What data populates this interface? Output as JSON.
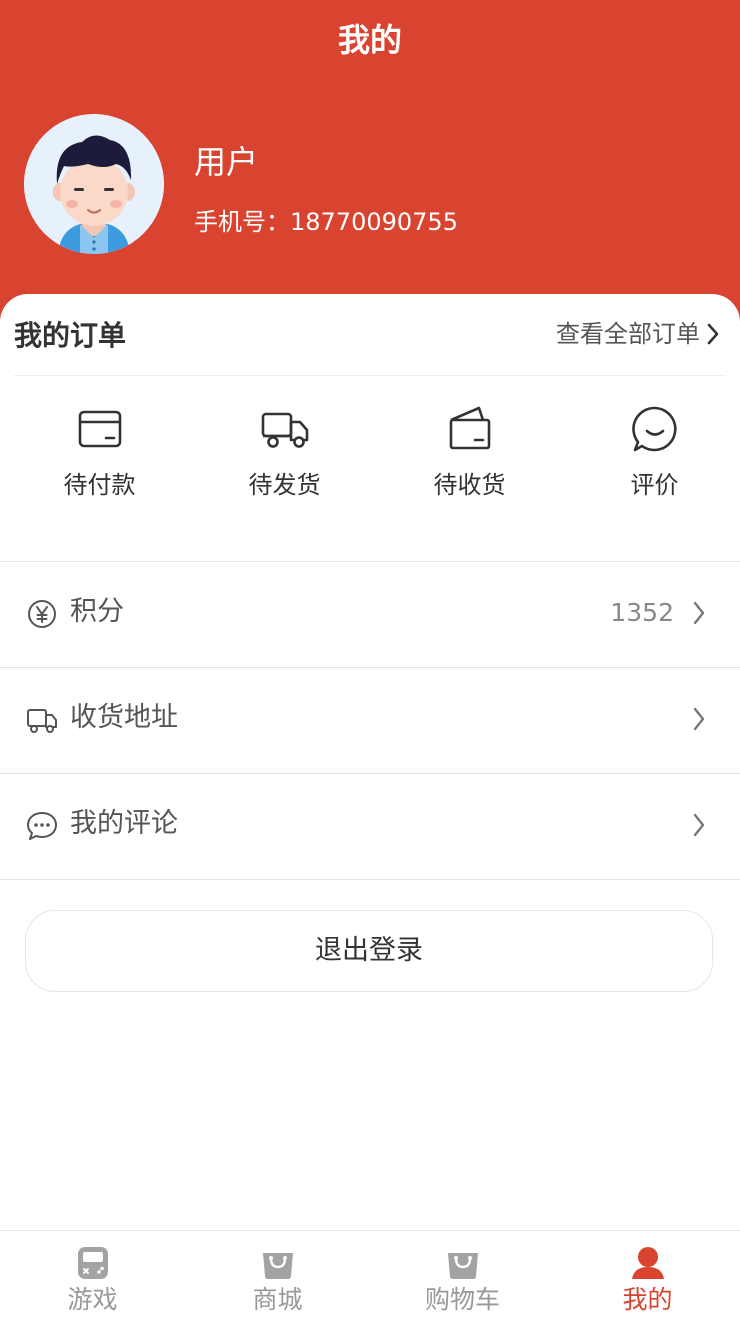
{
  "header": {
    "title": "我的",
    "bg_color": "#d94430"
  },
  "user": {
    "name": "用户",
    "phone": "手机号：18770090755",
    "avatar_icon": "avatar-boy-icon"
  },
  "orders": {
    "title": "我的订单",
    "view_all": "查看全部订单",
    "items": [
      {
        "label": "待付款",
        "icon": "wallet-icon"
      },
      {
        "label": "待发货",
        "icon": "truck-icon"
      },
      {
        "label": "待收货",
        "icon": "package-icon"
      },
      {
        "label": "评价",
        "icon": "comment-icon"
      }
    ]
  },
  "menu": [
    {
      "label": "积分",
      "value": "1352",
      "icon": "yuan-icon"
    },
    {
      "label": "收货地址",
      "value": "",
      "icon": "truck-icon"
    },
    {
      "label": "我的评论",
      "value": "",
      "icon": "chat-bubble-icon"
    }
  ],
  "logout_label": "退出登录",
  "tabbar": {
    "active_color": "#d94430",
    "items": [
      {
        "label": "游戏",
        "icon": "gamepad-icon",
        "active": false
      },
      {
        "label": "商城",
        "icon": "shopping-bag-icon",
        "active": false
      },
      {
        "label": "购物车",
        "icon": "shopping-bag-icon",
        "active": false
      },
      {
        "label": "我的",
        "icon": "user-icon",
        "active": true
      }
    ]
  }
}
